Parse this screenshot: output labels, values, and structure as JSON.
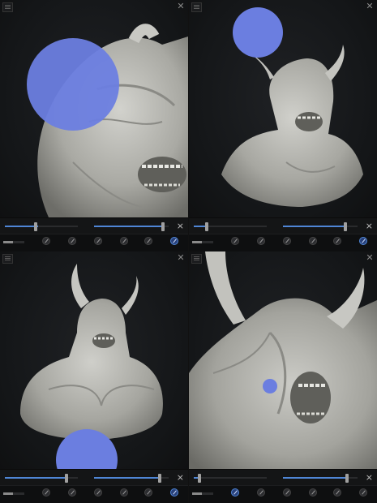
{
  "app": {
    "accent_color": "#4f86d6",
    "brush_cursor_color": "#6b7ee0",
    "background_color": "#16181a",
    "model_color": "#b9b9b4"
  },
  "panels": [
    {
      "view": "closeup-left-face",
      "sliders": {
        "radius": 0.45,
        "intensity": 0.92
      },
      "brush_cursor_size": "large",
      "active_tool": 5,
      "tools": [
        "brush-icon",
        "brush-icon",
        "brush-icon",
        "brush-icon",
        "brush-icon",
        "brush-icon"
      ]
    },
    {
      "view": "bust-front-three-quarter",
      "sliders": {
        "radius": 0.18,
        "intensity": 0.84
      },
      "brush_cursor_size": "medium",
      "active_tool": 5,
      "tools": [
        "brush-icon",
        "brush-icon",
        "brush-icon",
        "brush-icon",
        "brush-icon",
        "brush-icon"
      ]
    },
    {
      "view": "torso-front",
      "sliders": {
        "radius": 0.85,
        "intensity": 0.88
      },
      "brush_cursor_size": "large",
      "active_tool": 5,
      "tools": [
        "brush-icon",
        "brush-icon",
        "brush-icon",
        "brush-icon",
        "brush-icon",
        "brush-icon"
      ]
    },
    {
      "view": "closeup-right-horn",
      "sliders": {
        "radius": 0.08,
        "intensity": 0.86
      },
      "brush_cursor_size": "small",
      "active_tool": 1,
      "tools": [
        "brush-icon",
        "brush-icon",
        "brush-icon",
        "brush-icon",
        "brush-icon",
        "brush-icon"
      ]
    }
  ]
}
